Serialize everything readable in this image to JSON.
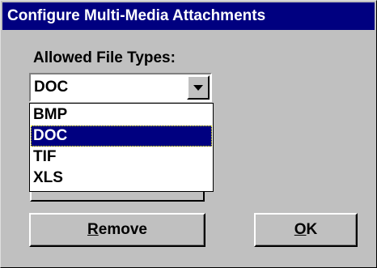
{
  "window": {
    "title": "Configure Multi-Media Attachments"
  },
  "file_types": {
    "label": "Allowed File Types:",
    "selected": "DOC",
    "options": [
      "BMP",
      "DOC",
      "TIF",
      "XLS"
    ],
    "selected_index": 1
  },
  "buttons": {
    "remove": {
      "mnemonic": "R",
      "rest": "emove"
    },
    "ok": {
      "mnemonic": "O",
      "rest": "K"
    }
  },
  "colors": {
    "titlebar": "#000080",
    "face": "#c0c0c0",
    "highlight": "#000080"
  }
}
